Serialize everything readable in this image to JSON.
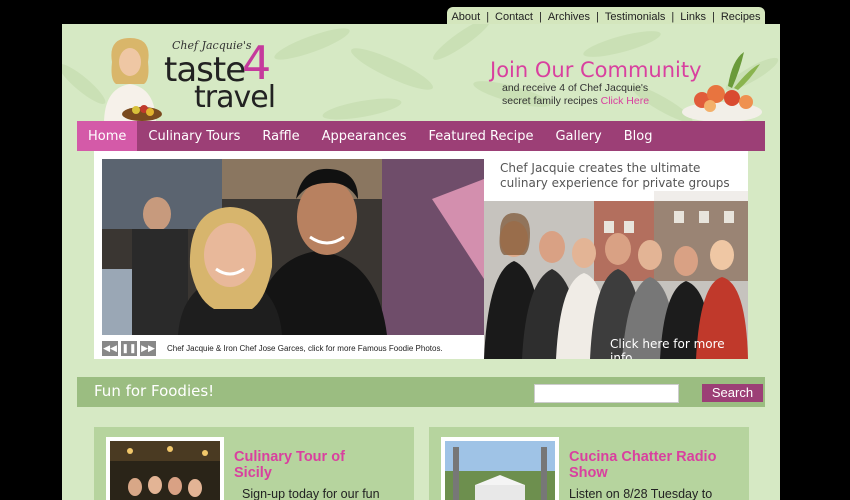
{
  "top_nav": {
    "links": [
      "About",
      "Contact",
      "Archives",
      "Testimonials",
      "Links",
      "Recipes"
    ]
  },
  "header": {
    "logo_small": "Chef Jacquie's",
    "logo_taste": "taste",
    "logo_four": "4",
    "logo_travel": "travel",
    "join_headline": "Join Our Community",
    "join_line1": "and receive 4 of Chef Jacquie's",
    "join_line2": "secret family recipes",
    "join_click": "Click Here"
  },
  "main_nav": {
    "items": [
      "Home",
      "Culinary Tours",
      "Raffle",
      "Appearances",
      "Featured Recipe",
      "Gallery",
      "Blog"
    ],
    "active": "Home"
  },
  "slideshow": {
    "caption": "Chef Jacquie & Iron Chef Jose Garces, click for more Famous Foodie Photos.",
    "controls": [
      "rewind-icon",
      "pause-icon",
      "forward-icon"
    ]
  },
  "promo": {
    "line1": "Chef Jacquie creates the ultimate",
    "line2": "culinary experience for private groups",
    "link": "Click here for more info"
  },
  "fun_bar": {
    "title": "Fun for Foodies!",
    "search_value": "",
    "search_button": "Search"
  },
  "cards": [
    {
      "title_line1": "Culinary Tour of",
      "title_line2": "Sicily",
      "text": "Sign-up today for our fun"
    },
    {
      "title_line1": "Cucina Chatter Radio",
      "title_line2": "Show",
      "text": "Listen on 8/28 Tuesday to"
    }
  ],
  "colors": {
    "panel_green": "#d6e9c4",
    "nav_purple": "#9c3f76",
    "nav_active": "#d45aa8",
    "accent_pink": "#d9409f",
    "bar_green": "#9bbd81"
  }
}
